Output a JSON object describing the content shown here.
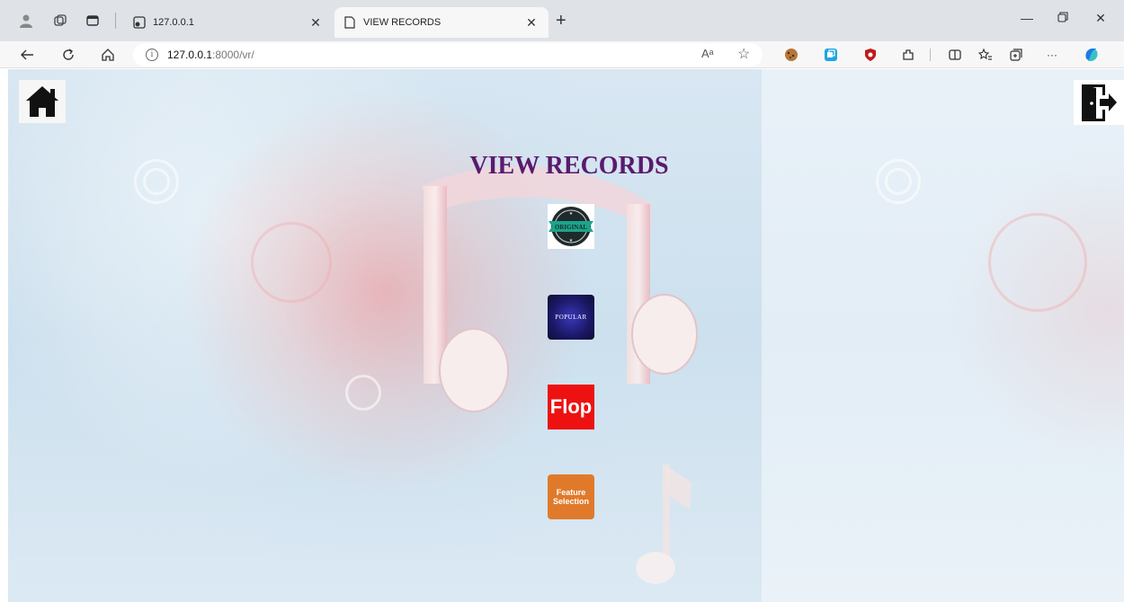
{
  "browser": {
    "tabs": [
      {
        "title": "127.0.0.1",
        "active": false
      },
      {
        "title": "VIEW RECORDS",
        "active": true
      }
    ],
    "url": {
      "host": "127.0.0.1",
      "path": ":8000/vr/"
    },
    "icons": {
      "profile": "profile-icon",
      "workspaces": "workspaces-icon",
      "tab_actions": "tab-actions-icon",
      "back": "back-arrow-icon",
      "refresh": "refresh-icon",
      "home": "home-icon",
      "read_aloud": "read-aloud-icon",
      "favorite": "star-icon",
      "more": "more-icon"
    },
    "read_aloud_label": "Aᵃ",
    "more_label": "···"
  },
  "page": {
    "title": "VIEW RECORDS",
    "buttons": {
      "original_label": "ORIGINAL",
      "popular_label": "POPULAR",
      "flop_label": "Flop",
      "feature_line1": "Feature",
      "feature_line2": "Selection"
    },
    "colors": {
      "title": "#5a1a6e",
      "flop": "#ee1111",
      "feature": "#e07a2a",
      "popular": "#1b1866",
      "original_ribbon": "#1aa58c"
    }
  }
}
